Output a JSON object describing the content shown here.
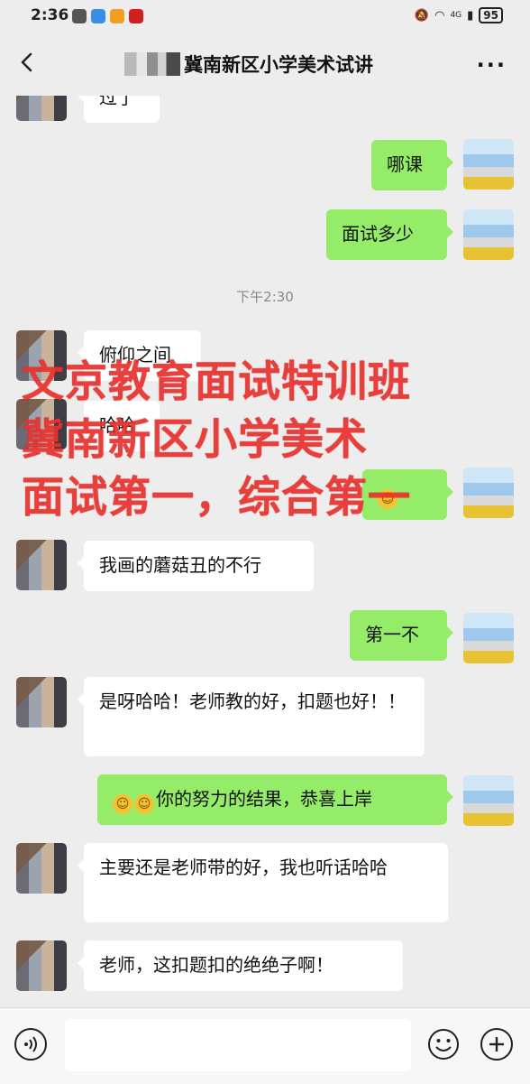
{
  "status_bar": {
    "time": "2:36",
    "network": "4G",
    "battery": "95"
  },
  "header": {
    "title": "冀南新区小学美术试讲",
    "more": "···"
  },
  "messages": {
    "m0": "过了",
    "m1": "哪课",
    "m2": "面试多少",
    "timestamp": "下午2:30",
    "m3": "俯仰之间",
    "m4": "哈哈",
    "m5": "我画的蘑菇丑的不行",
    "m6": "第一不",
    "m7": "是呀哈哈！老师教的好，扣题也好！！",
    "m8": "你的努力的结果，恭喜上岸",
    "m9": "主要还是老师带的好，我也听话哈哈",
    "m10": "老师，这扣题扣的绝绝子啊！"
  },
  "watermark": {
    "line1": "文京教育面试特训班",
    "line2": "冀南新区小学美术",
    "line3": "面试第一，综合第一"
  },
  "colors": {
    "sent_bubble": "#95ec69",
    "received_bubble": "#ffffff",
    "watermark": "#e8322f",
    "background": "#ededed"
  },
  "icons": [
    "back-arrow-icon",
    "more-icon",
    "voice-icon",
    "emoji-icon",
    "plus-icon"
  ]
}
